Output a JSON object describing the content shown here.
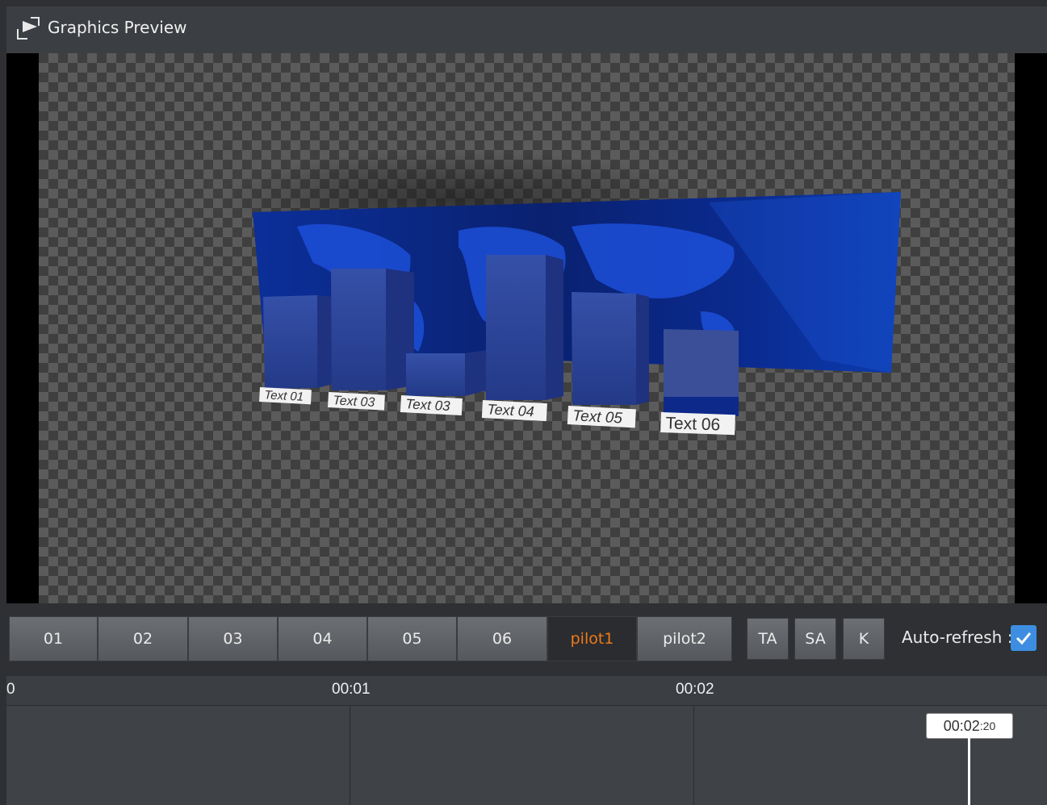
{
  "window": {
    "title": "Graphics Preview",
    "icon": "preview-arrow-icon"
  },
  "viewport": {
    "bar_labels": [
      "Text 01",
      "Text 03",
      "Text 03",
      "Text 04",
      "Text 05",
      "Text 06"
    ],
    "background": "transparency-checkerboard",
    "colors": {
      "bars": "#2f4aa0",
      "map": "#0b2a8a"
    }
  },
  "toolbar": {
    "segments": [
      "01",
      "02",
      "03",
      "04",
      "05",
      "06",
      "pilot1",
      "pilot2"
    ],
    "active_segment": "pilot1",
    "buttons": [
      "TA",
      "SA",
      "K"
    ],
    "auto_refresh_label": "Auto-refresh :",
    "auto_refresh_checked": true,
    "accent_color": "#f07a1a",
    "checkbox_color": "#3d8ee0"
  },
  "timeline": {
    "ticks": [
      "0",
      "00:01",
      "00:02"
    ],
    "playhead_main": "00:02",
    "playhead_frames": ":20"
  }
}
